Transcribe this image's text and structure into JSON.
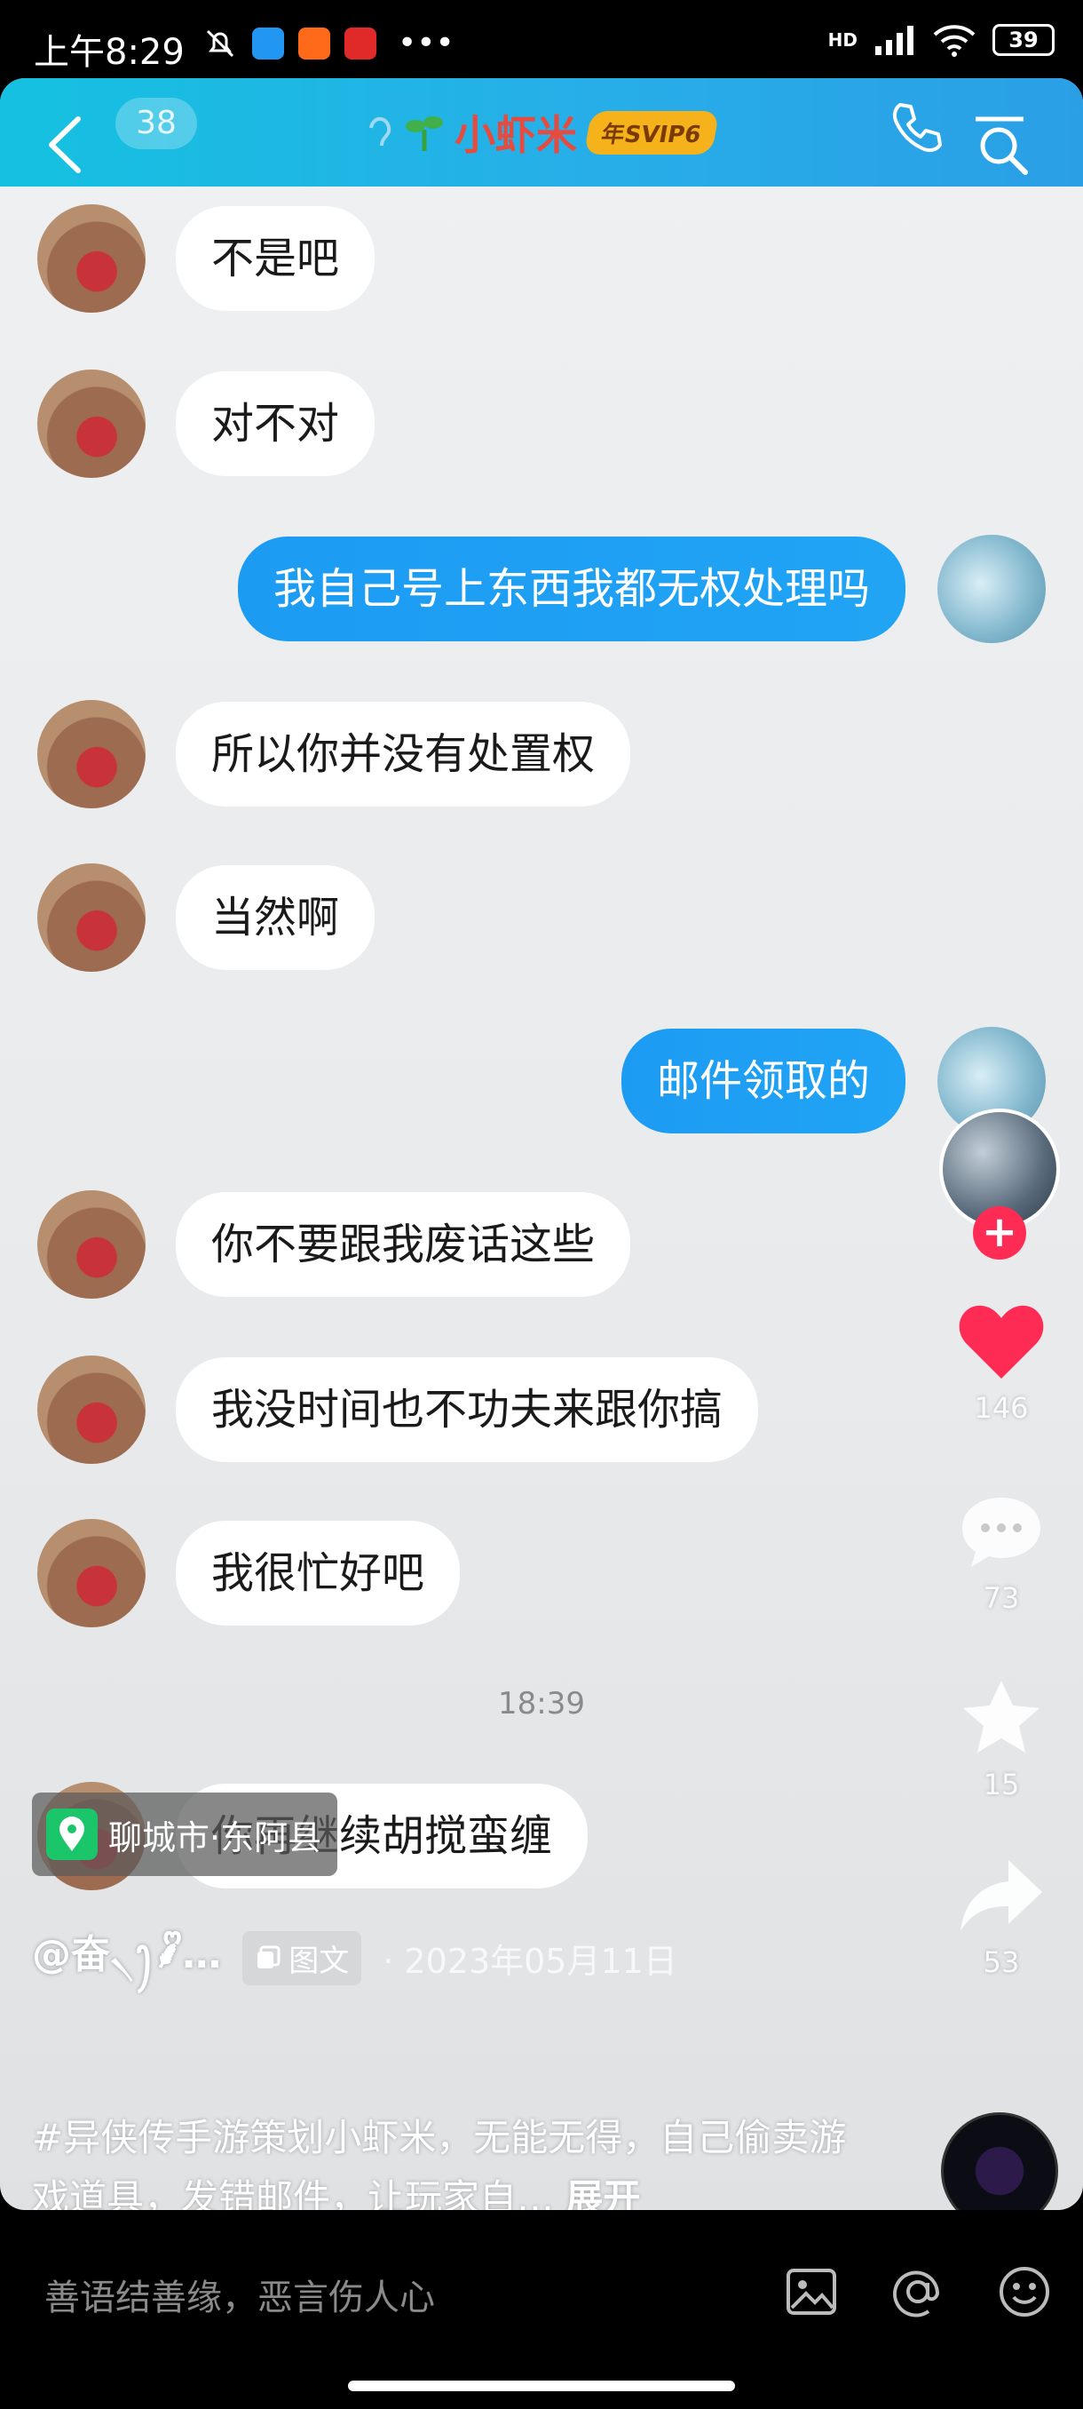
{
  "status_bar": {
    "time": "上午8:29",
    "network": "HD",
    "battery": "39"
  },
  "chat_header": {
    "unread_count": "38",
    "title": "小虾米",
    "badge": "年SVIP6"
  },
  "messages": [
    {
      "side": "left",
      "text": "不是吧"
    },
    {
      "side": "left",
      "text": "对不对"
    },
    {
      "side": "right",
      "text": "我自己号上东西我都无权处理吗"
    },
    {
      "side": "left",
      "text": "所以你并没有处置权"
    },
    {
      "side": "left",
      "text": "当然啊"
    },
    {
      "side": "right",
      "text": "邮件领取的"
    },
    {
      "side": "left",
      "text": "你不要跟我废话这些"
    },
    {
      "side": "left",
      "text": "我没时间也不功夫来跟你搞"
    },
    {
      "side": "left",
      "text": "我很忙好吧"
    },
    {
      "side": "left",
      "text": "你再继续胡搅蛮缠"
    }
  ],
  "timestamp": "18:39",
  "rail": {
    "likes": "146",
    "comments": "73",
    "favorites": "15",
    "shares": "53"
  },
  "post": {
    "location": "聊城市·东阿县",
    "author": "@奋৲ꫂ⸙ᩚ…",
    "type_tag": "图文",
    "date": "· 2023年05月11日",
    "caption": "#异侠传手游策划小虾米，无能无得，自己偷卖游戏道具，发错邮件，让玩家自…",
    "expand": "展开"
  },
  "comment_bar": {
    "placeholder": "善语结善缘，恶言伤人心"
  },
  "colors": {
    "qq_blue": "#21a4f4",
    "like_red": "#fe2c55",
    "location_green": "#1bc56a"
  }
}
